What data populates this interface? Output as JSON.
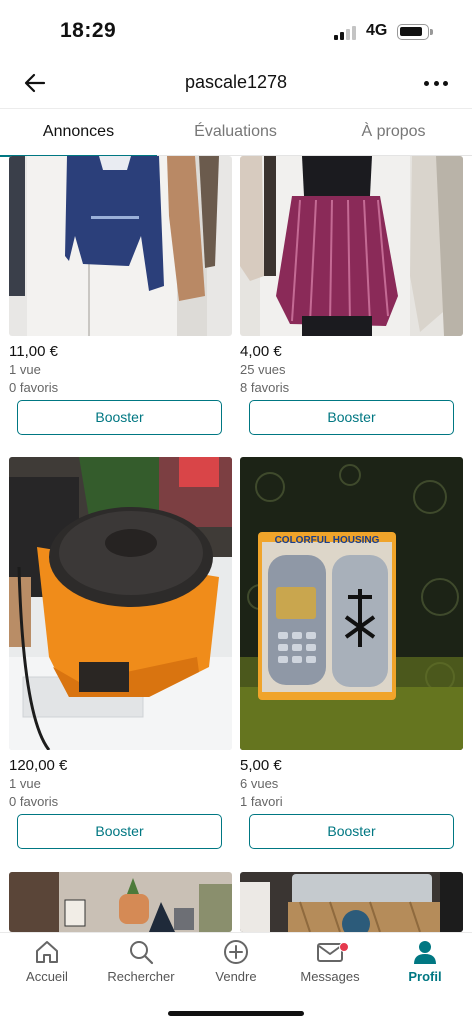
{
  "status_bar": {
    "time": "18:29",
    "network": "4G"
  },
  "header": {
    "title": "pascale1278"
  },
  "tabs": [
    {
      "label": "Annonces",
      "active": true
    },
    {
      "label": "Évaluations",
      "active": false
    },
    {
      "label": "À propos",
      "active": false
    }
  ],
  "listings": [
    {
      "price": "11,00 €",
      "views": "1 vue",
      "favorites": "0 favoris",
      "button": "Booster",
      "image": "clothes-on-door-photo"
    },
    {
      "price": "4,00 €",
      "views": "25 vues",
      "favorites": "8 favoris",
      "button": "Booster",
      "image": "pink-striped-skirt-photo"
    },
    {
      "price": "120,00 €",
      "views": "1 vue",
      "favorites": "0 favoris",
      "button": "Booster",
      "image": "orange-appliance-photo"
    },
    {
      "price": "5,00 €",
      "views": "6 vues",
      "favorites": "1 favori",
      "button": "Booster",
      "image": "phone-housing-photo"
    },
    {
      "image": "shelf-items-photo"
    },
    {
      "image": "storage-box-photo"
    }
  ],
  "packaging_text": "COLORFUL HOUSING",
  "bottom_nav": [
    {
      "label": "Accueil",
      "icon": "home-icon",
      "active": false
    },
    {
      "label": "Rechercher",
      "icon": "search-icon",
      "active": false
    },
    {
      "label": "Vendre",
      "icon": "plus-circle-icon",
      "active": false
    },
    {
      "label": "Messages",
      "icon": "envelope-icon",
      "active": false,
      "notification": true
    },
    {
      "label": "Profil",
      "icon": "profile-icon",
      "active": true
    }
  ],
  "colors": {
    "accent": "#007782",
    "badge": "#e5394d"
  }
}
